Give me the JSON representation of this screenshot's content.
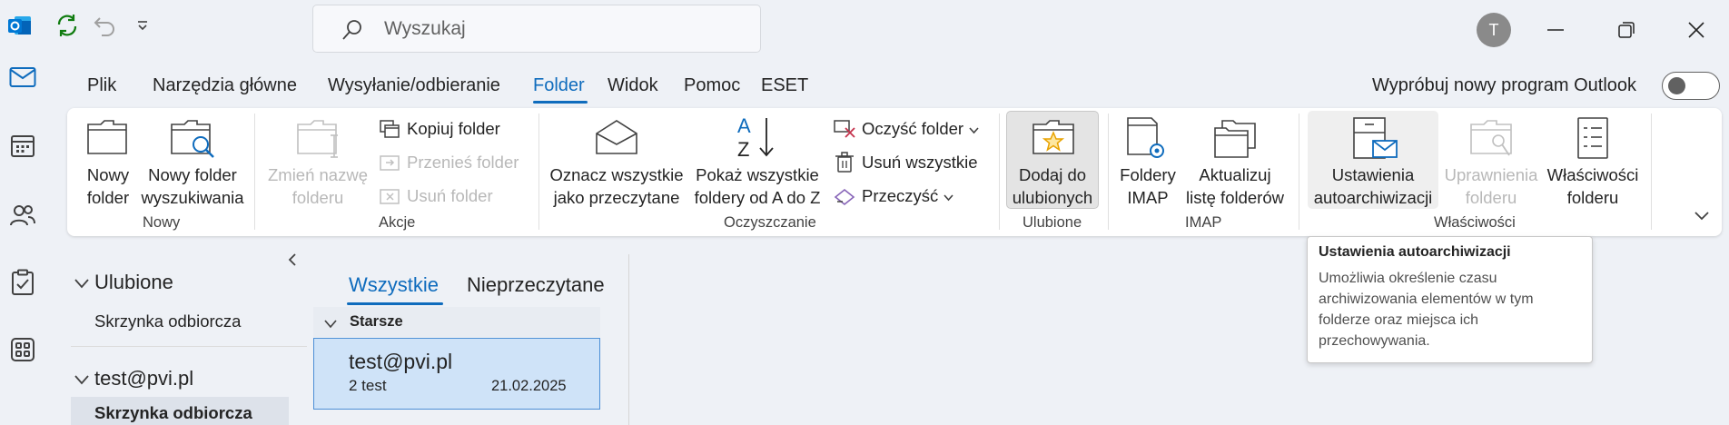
{
  "titlebar": {
    "search_placeholder": "Wyszukaj",
    "avatar_initial": "T"
  },
  "menu": {
    "tabs": [
      "Plik",
      "Narzędzia główne",
      "Wysyłanie/odbieranie",
      "Folder",
      "Widok",
      "Pomoc",
      "ESET"
    ],
    "active_tab": "Folder",
    "try_new_outlook": "Wypróbuj nowy program Outlook",
    "toggle_state": "off"
  },
  "ribbon": {
    "groups": {
      "nowy": {
        "label": "Nowy",
        "new_folder": [
          "Nowy",
          "folder"
        ],
        "new_search_folder": [
          "Nowy folder",
          "wyszukiwania"
        ]
      },
      "akcje": {
        "label": "Akcje",
        "rename_folder": [
          "Zmień nazwę",
          "folderu"
        ],
        "copy_folder": "Kopiuj folder",
        "move_folder": "Przenieś folder",
        "delete_folder": "Usuń folder"
      },
      "oczyszczanie": {
        "label": "Oczyszczanie",
        "mark_all_read": [
          "Oznacz wszystkie",
          "jako przeczytane"
        ],
        "show_all_folders": [
          "Pokaż wszystkie",
          "foldery od A do Z"
        ],
        "clean_folder": "Oczyść folder",
        "delete_all": "Usuń wszystkie",
        "cleanup": "Przeczyść"
      },
      "ulubione": {
        "label": "Ulubione",
        "add_to_favorites": [
          "Dodaj do",
          "ulubionych"
        ]
      },
      "imap": {
        "label": "IMAP",
        "imap_folders": [
          "Foldery",
          "IMAP"
        ],
        "update_folder_list": [
          "Aktualizuj",
          "listę folderów"
        ]
      },
      "wlasciwosci": {
        "label": "Właściwości",
        "autoarchive": [
          "Ustawienia",
          "autoarchiwizacji"
        ],
        "permissions": [
          "Uprawnienia",
          "folderu"
        ],
        "properties": [
          "Właściwości",
          "folderu"
        ]
      }
    }
  },
  "folder_pane": {
    "favorites_header": "Ulubione",
    "favorites_inbox": "Skrzynka odbiorcza",
    "account_header": "test@pvi.pl",
    "account_inbox": "Skrzynka odbiorcza"
  },
  "message_list": {
    "tab_all": "Wszystkie",
    "tab_unread": "Nieprzeczytane",
    "group_label": "Starsze",
    "message": {
      "sender": "test@pvi.pl",
      "subject": "2 test",
      "date": "21.02.2025"
    }
  },
  "tooltip": {
    "title": "Ustawienia autoarchiwizacji",
    "body_lines": [
      "Umożliwia określenie czasu",
      "archiwizowania elementów w tym",
      "folderze oraz miejsca ich",
      "przechowywania."
    ]
  },
  "colors": {
    "accent": "#0f6cbd",
    "app_background": "#eef1f6",
    "selected_message": "#cfe3f8",
    "disabled_text": "#b8b8b8"
  },
  "icons": {
    "rail": [
      "mail-icon",
      "calendar-icon",
      "people-icon",
      "tasks-icon",
      "apps-icon"
    ],
    "titlebar": [
      "outlook-logo-icon",
      "sync-icon",
      "undo-icon",
      "customize-qat-icon",
      "search-icon",
      "minimize-icon",
      "restore-icon",
      "close-icon"
    ]
  }
}
